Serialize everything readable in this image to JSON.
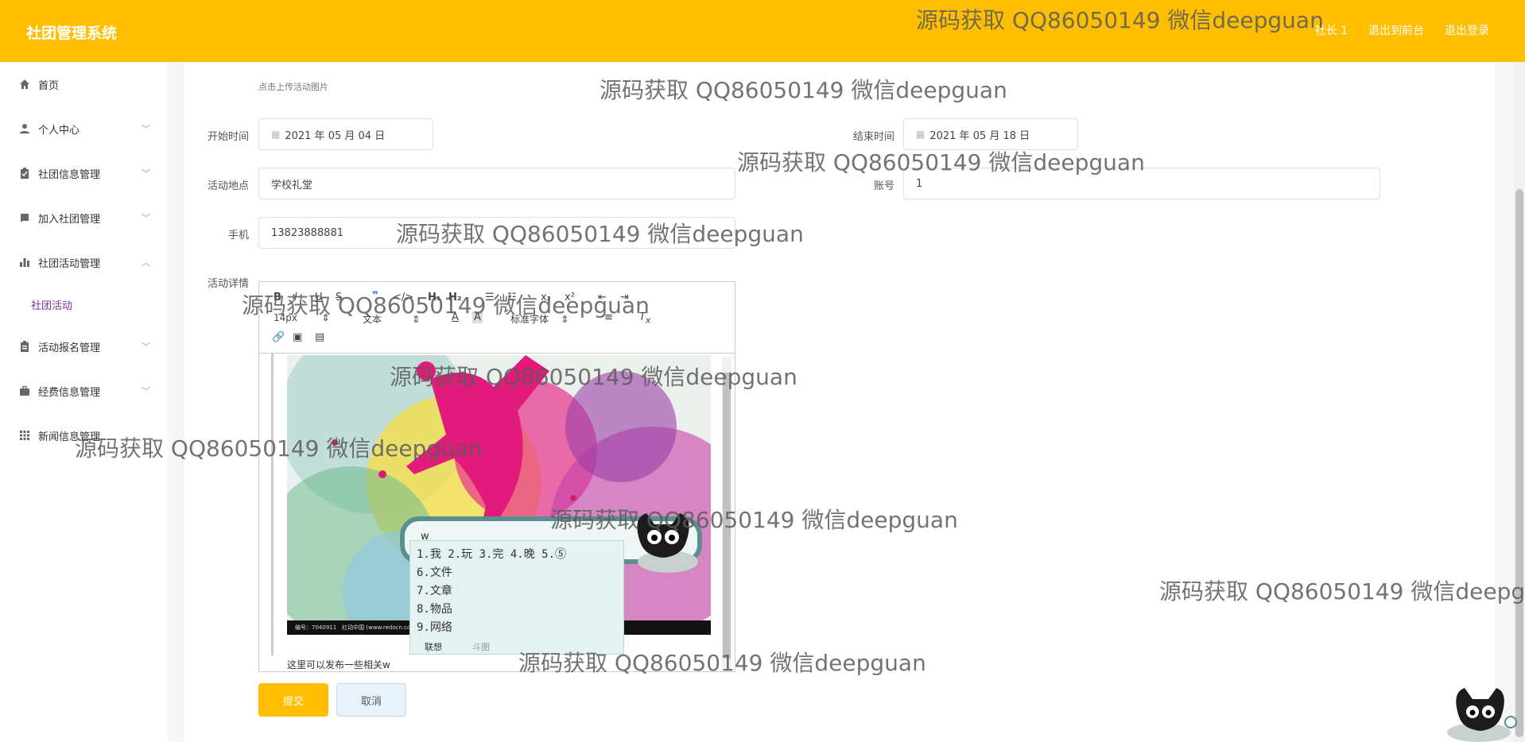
{
  "header": {
    "brand": "社团管理系统",
    "links": [
      "社长 1",
      "退出到前台",
      "退出登录"
    ]
  },
  "sidebar": {
    "items": [
      {
        "label": "首页",
        "icon": "home-icon"
      },
      {
        "label": "个人中心",
        "icon": "user-icon"
      },
      {
        "label": "社团信息管理",
        "icon": "clipboard-icon"
      },
      {
        "label": "加入社团管理",
        "icon": "book-icon"
      },
      {
        "label": "社团活动管理",
        "icon": "bar-chart-icon"
      },
      {
        "label": "活动报名管理",
        "icon": "clipboard-icon"
      },
      {
        "label": "经费信息管理",
        "icon": "briefcase-icon"
      },
      {
        "label": "新闻信息管理",
        "icon": "grid-icon"
      }
    ],
    "sub_item": "社团活动"
  },
  "form": {
    "upload_hint": "点击上传活动图片",
    "start_label": "开始时间",
    "start_value": "2021 年 05 月 04 日",
    "end_label": "结束时间",
    "end_value": "2021 年 05 月 18 日",
    "location_label": "活动地点",
    "location_value": "学校礼堂",
    "account_label": "账号",
    "account_value": "1",
    "phone_label": "手机",
    "phone_value": "13823888881",
    "detail_label": "活动详情"
  },
  "editor": {
    "font_size": "14px",
    "block_type": "文本",
    "font_family": "标准字体",
    "image_caption": "编号：7040911　红动中国 (www.redocn.com)",
    "text": "这里可以发布一些相关w"
  },
  "ime": {
    "composition": "w",
    "candidates_row": "1.我 2.玩 3.完 4.晚 5.⑤",
    "candidates": [
      "6.文件",
      "7.文章",
      "8.物品",
      "9.网络"
    ],
    "tabs": [
      "联想",
      "斗图"
    ]
  },
  "buttons": {
    "submit": "提交",
    "cancel": "取消"
  },
  "watermark": "源码获取 QQ86050149 微信deepguan",
  "colors": {
    "accent": "#ffbf00",
    "submenu_active": "#7b2ea0",
    "ime_border": "#5b8f8f"
  }
}
